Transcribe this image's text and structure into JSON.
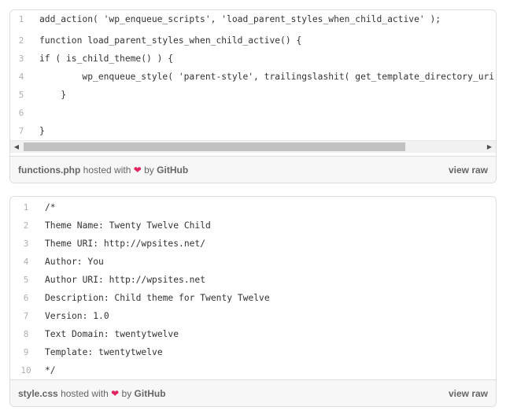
{
  "gists": [
    {
      "lines": [
        {
          "num": "1",
          "text": "add_action( 'wp_enqueue_scripts', 'load_parent_styles_when_child_active' );"
        },
        {
          "num": "2",
          "text": "function load_parent_styles_when_child_active() {"
        },
        {
          "num": "3",
          "text": "if ( is_child_theme() ) {"
        },
        {
          "num": "4",
          "text": "        wp_enqueue_style( 'parent-style', trailingslashit( get_template_directory_uri() ) ."
        },
        {
          "num": "5",
          "text": "    }"
        },
        {
          "num": "6",
          "text": ""
        },
        {
          "num": "7",
          "text": "}"
        }
      ],
      "filename": "functions.php",
      "hosted_with": "hosted with",
      "by": "by",
      "brand": "GitHub",
      "view_raw": "view raw"
    },
    {
      "lines": [
        {
          "num": "1",
          "text": "/*"
        },
        {
          "num": "2",
          "text": "Theme Name: Twenty Twelve Child"
        },
        {
          "num": "3",
          "text": "Theme URI: http://wpsites.net/"
        },
        {
          "num": "4",
          "text": "Author: You"
        },
        {
          "num": "5",
          "text": "Author URI: http://wpsites.net"
        },
        {
          "num": "6",
          "text": "Description: Child theme for Twenty Twelve"
        },
        {
          "num": "7",
          "text": "Version: 1.0"
        },
        {
          "num": "8",
          "text": "Text Domain: twentytwelve"
        },
        {
          "num": "9",
          "text": "Template: twentytwelve"
        },
        {
          "num": "10",
          "text": "*/"
        }
      ],
      "filename": "style.css",
      "hosted_with": "hosted with",
      "by": "by",
      "brand": "GitHub",
      "view_raw": "view raw"
    }
  ],
  "colors": {
    "heart": "#e0245e",
    "border": "#dddddd",
    "meta_bg": "#f7f7f7"
  },
  "icons": {
    "heart": "heart-icon",
    "scroll_left": "chevron-left-icon",
    "scroll_right": "chevron-right-icon"
  }
}
